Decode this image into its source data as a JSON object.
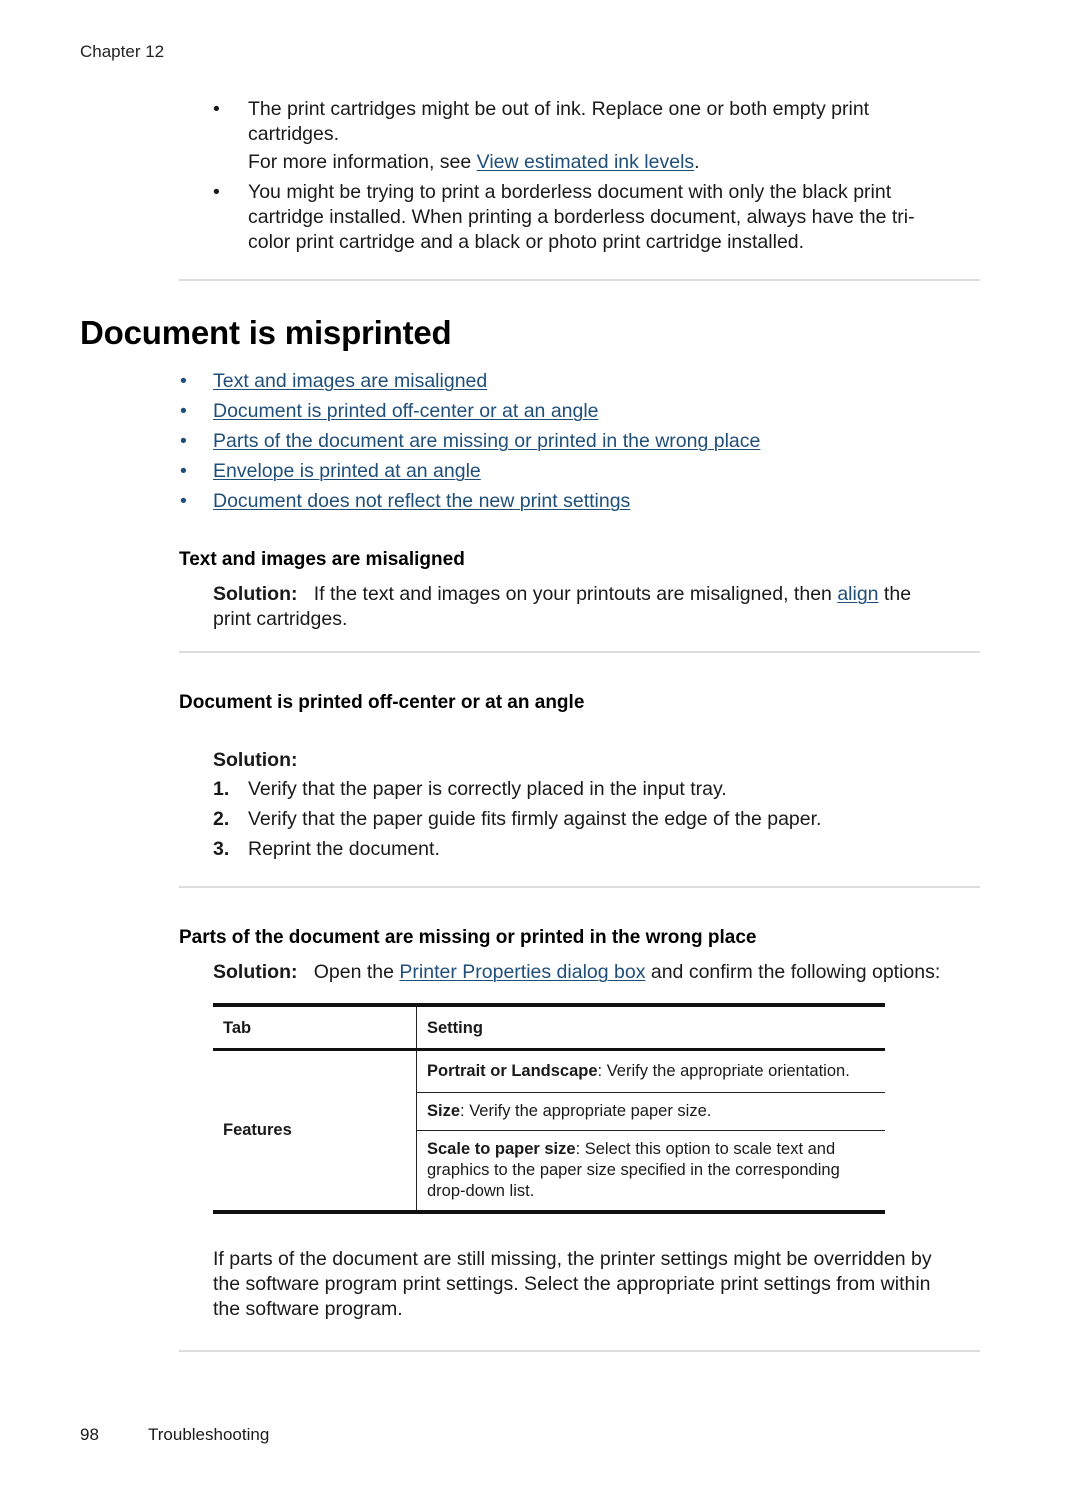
{
  "header": {
    "chapter": "Chapter 12"
  },
  "intro_bullets": [
    {
      "line1": "The print cartridges might be out of ink. Replace one or both empty print",
      "line2": "cartridges.",
      "more_prefix": "For more information, see ",
      "more_link": "View estimated ink levels",
      "more_suffix": "."
    },
    {
      "line1": "You might be trying to print a borderless document with only the black print",
      "line2": "cartridge installed. When printing a borderless document, always have the tri-",
      "line3": "color print cartridge and a black or photo print cartridge installed."
    }
  ],
  "section": {
    "title": "Document is misprinted",
    "toc": [
      "Text and images are misaligned",
      "Document is printed off-center or at an angle",
      "Parts of the document are missing or printed in the wrong place",
      "Envelope is printed at an angle",
      "Document does not reflect the new print settings"
    ],
    "bullet_char": "•"
  },
  "misaligned": {
    "heading": "Text and images are misaligned",
    "solution_label": "Solution:",
    "text_before": "If the text and images on your printouts are misaligned, then ",
    "link": "align",
    "text_after": " the",
    "line2": "print cartridges."
  },
  "offcenter": {
    "heading": "Document is printed off-center or at an angle",
    "solution_label": "Solution:",
    "steps": [
      {
        "num": "1.",
        "text": "Verify that the paper is correctly placed in the input tray."
      },
      {
        "num": "2.",
        "text": "Verify that the paper guide fits firmly against the edge of the paper."
      },
      {
        "num": "3.",
        "text": "Reprint the document."
      }
    ]
  },
  "missing": {
    "heading": "Parts of the document are missing or printed in the wrong place",
    "solution_label": "Solution:",
    "text_before": "Open the ",
    "link": "Printer Properties dialog box",
    "text_after": " and confirm the following options:",
    "table": {
      "headers": [
        "Tab",
        "Setting"
      ],
      "tab_value": "Features",
      "settings": [
        {
          "bold": "Portrait or Landscape",
          "text": ": Verify the appropriate orientation."
        },
        {
          "bold": "Size",
          "text": ": Verify the appropriate paper size."
        },
        {
          "bold": "Scale to paper size",
          "text": ": Select this option to scale text and graphics to the paper size specified in the corresponding drop-down list."
        }
      ]
    },
    "followup_line1": "If parts of the document are still missing, the printer settings might be overridden by",
    "followup_line2": "the software program print settings. Select the appropriate print settings from within",
    "followup_line3": "the software program."
  },
  "footer": {
    "page_number": "98",
    "section": "Troubleshooting"
  },
  "colors": {
    "link": "#1f4e79",
    "rule": "#dcdcdc"
  }
}
